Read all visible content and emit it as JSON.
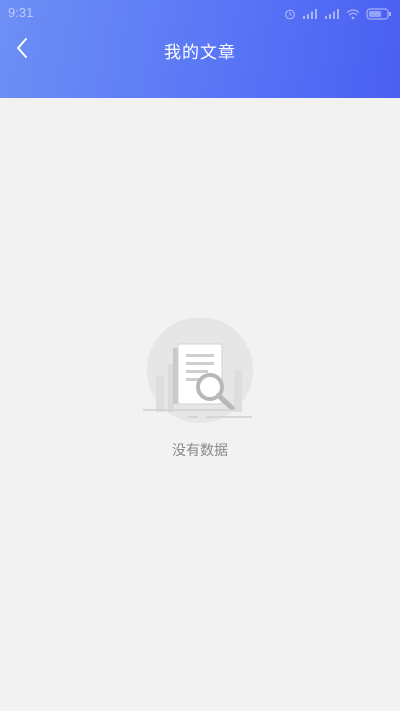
{
  "status_bar": {
    "time": "9:31",
    "icons": [
      "alarm-icon",
      "signal-icon",
      "signal-icon",
      "wifi-icon",
      "battery-icon"
    ]
  },
  "header": {
    "title": "我的文章",
    "back_icon": "chevron-left-icon",
    "gradient_colors": [
      "#6d8ff5",
      "#4a5ff2"
    ]
  },
  "empty_state": {
    "message": "没有数据",
    "illustration": "document-search-icon"
  },
  "colors": {
    "background": "#f2f2f2",
    "empty_text": "#888888"
  }
}
